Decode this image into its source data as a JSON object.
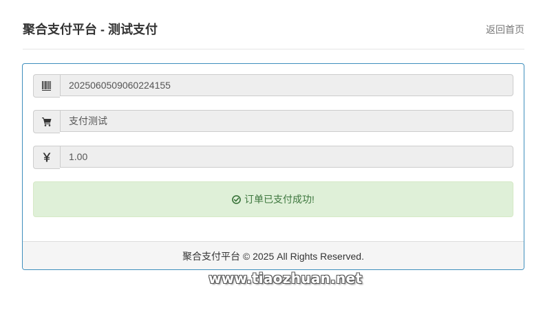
{
  "header": {
    "title": "聚合支付平台 - 测试支付",
    "back_link": "返回首页"
  },
  "order": {
    "order_no": "2025060509060224155",
    "order_no_icon": "barcode-icon",
    "product_name": "支付测试",
    "product_icon": "shopping-cart-icon",
    "amount": "1.00",
    "amount_icon": "yen-icon"
  },
  "status": {
    "message": "订单已支付成功!",
    "icon": "check-circle-icon",
    "color": "#3c763d",
    "background": "#dff0d8"
  },
  "footer": {
    "copyright": "聚合支付平台 © 2025 All Rights Reserved."
  },
  "watermark": {
    "text": "www.tiaozhuan.net"
  },
  "colors": {
    "panel_border": "#3c8dbc",
    "addon_background": "#eeeeee"
  }
}
